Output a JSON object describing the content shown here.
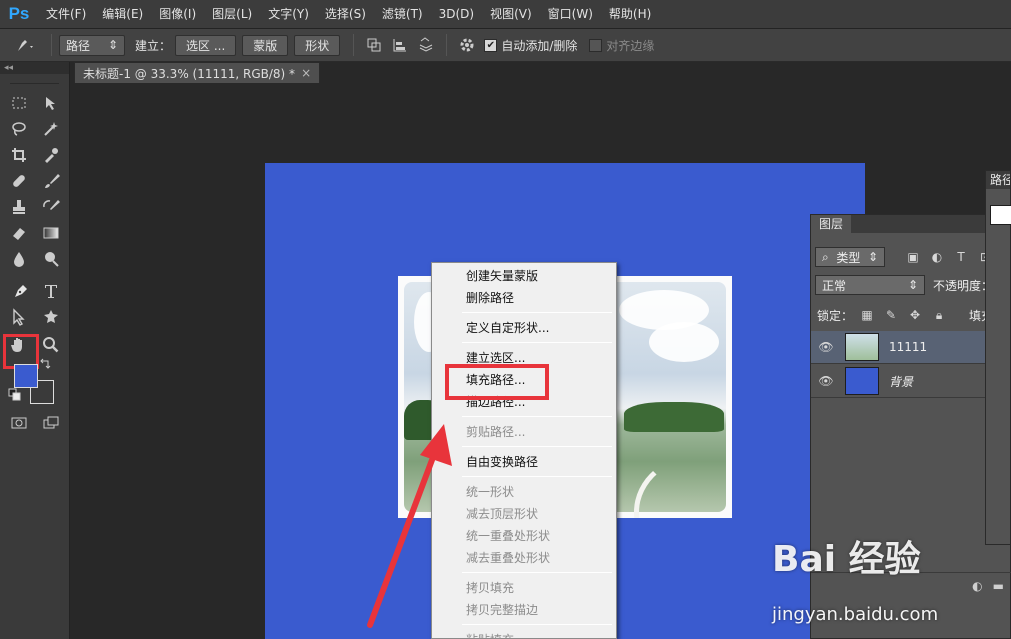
{
  "app": {
    "logo": "Ps"
  },
  "menu": [
    {
      "label": "文件(F)"
    },
    {
      "label": "编辑(E)"
    },
    {
      "label": "图像(I)"
    },
    {
      "label": "图层(L)"
    },
    {
      "label": "文字(Y)"
    },
    {
      "label": "选择(S)"
    },
    {
      "label": "滤镜(T)"
    },
    {
      "label": "3D(D)"
    },
    {
      "label": "视图(V)"
    },
    {
      "label": "窗口(W)"
    },
    {
      "label": "帮助(H)"
    }
  ],
  "options": {
    "mode_select": "路径",
    "make_label": "建立：",
    "selection_button": "选区 ...",
    "mask_button": "蒙版",
    "shape_button": "形状",
    "auto_add_label": "自动添加/删除",
    "auto_add_checked": true,
    "align_edges_label": "对齐边缘",
    "align_edges_checked": false
  },
  "tools": {
    "collapse_glyph": "◂◂",
    "active_tool": "pen-tool"
  },
  "colors": {
    "foreground": "#3a5bcf",
    "background": "#3a3a3a",
    "accent": "#e8343b",
    "canvas_blue": "#3a5bcf"
  },
  "document": {
    "tab_title": "未标题-1 @ 33.3% (11111, RGB/8) *",
    "close": "×"
  },
  "context_menu": {
    "items": [
      {
        "label": "创建矢量蒙版",
        "enabled": true
      },
      {
        "label": "删除路径",
        "enabled": true
      },
      {
        "label": "定义自定形状...",
        "enabled": true
      },
      {
        "label": "建立选区...",
        "enabled": true
      },
      {
        "label": "填充路径...",
        "enabled": true
      },
      {
        "label": "描边路径...",
        "enabled": true
      },
      {
        "label": "剪贴路径...",
        "enabled": false
      },
      {
        "label": "自由变换路径",
        "enabled": true
      },
      {
        "label": "统一形状",
        "enabled": false
      },
      {
        "label": "减去顶层形状",
        "enabled": false
      },
      {
        "label": "统一重叠处形状",
        "enabled": false
      },
      {
        "label": "减去重叠处形状",
        "enabled": false
      },
      {
        "label": "拷贝填充",
        "enabled": false
      },
      {
        "label": "拷贝完整描边",
        "enabled": false
      },
      {
        "label": "粘贴填充",
        "enabled": false
      }
    ],
    "highlighted": "填充路径..."
  },
  "layers_panel": {
    "tab": "图层",
    "filter_select": "类型",
    "blend_select": "正常",
    "opacity_label": "不透明度：",
    "lock_label": "锁定：",
    "fill_label": "填充：",
    "layers": [
      {
        "name": "11111",
        "selected": true
      },
      {
        "name": "背景",
        "selected": false
      }
    ]
  },
  "paths_panel": {
    "tab": "路径"
  },
  "watermark": {
    "logo": "Bai 经验",
    "url": "jingyan.baidu.com"
  }
}
